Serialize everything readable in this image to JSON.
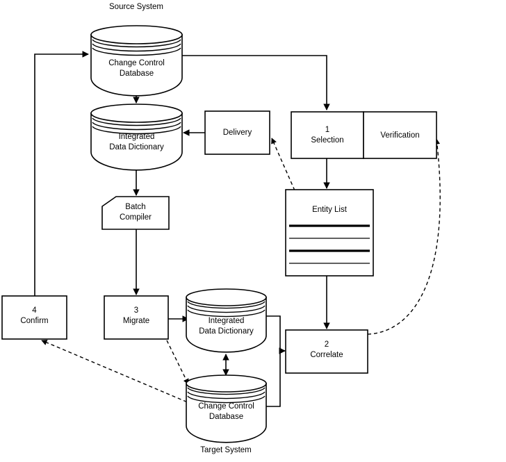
{
  "diagram": {
    "title": "Data dictionary migration flow diagram",
    "captions": {
      "source_system": "Source System",
      "target_system": "Target System"
    },
    "colors": {
      "stroke": "#000000",
      "fill": "#ffffff",
      "background": "#ffffff"
    },
    "nodes": {
      "source_change_control_db": {
        "label_line1": "Change Control",
        "label_line2": "Database",
        "shape": "cylinder-database"
      },
      "source_integrated_dd": {
        "label_line1": "Integrated",
        "label_line2": "Data Dictionary",
        "shape": "cylinder-database"
      },
      "batch_compiler": {
        "label_line1": "Batch",
        "label_line2": "Compiler",
        "shape": "chamfered-rectangle"
      },
      "delivery": {
        "label": "Delivery",
        "shape": "rectangle"
      },
      "selection": {
        "number": "1",
        "label": "Selection",
        "shape": "rectangle"
      },
      "verification": {
        "label": "Verification",
        "shape": "rectangle"
      },
      "entity_list": {
        "label": "Entity List",
        "shape": "document-list",
        "rules": [
          "thick",
          "thin",
          "thick",
          "thin"
        ]
      },
      "correlate": {
        "number": "2",
        "label": "Correlate",
        "shape": "rectangle"
      },
      "migrate": {
        "number": "3",
        "label": "Migrate",
        "shape": "rectangle"
      },
      "confirm": {
        "number": "4",
        "label": "Confirm",
        "shape": "rectangle"
      },
      "target_integrated_dd": {
        "label_line1": "Integrated",
        "label_line2": "Data Dictionary",
        "shape": "cylinder-database"
      },
      "target_change_control_db": {
        "label_line1": "Change Control",
        "label_line2": "Database",
        "shape": "cylinder-database"
      }
    },
    "edges": [
      {
        "name": "confirm-to-source-change-control",
        "from": "confirm",
        "to": "source_change_control_db",
        "style": "solid",
        "arrow": "end"
      },
      {
        "name": "source-change-control-to-selection",
        "from": "source_change_control_db",
        "to": "selection",
        "style": "solid",
        "arrow": "end"
      },
      {
        "name": "source-change-control-to-integrated-dd",
        "from": "source_change_control_db",
        "to": "source_integrated_dd",
        "style": "solid",
        "arrow": "both"
      },
      {
        "name": "delivery-to-source-integrated-dd",
        "from": "delivery",
        "to": "source_integrated_dd",
        "style": "solid",
        "arrow": "end"
      },
      {
        "name": "source-integrated-dd-to-batch-compiler",
        "from": "source_integrated_dd",
        "to": "batch_compiler",
        "style": "solid",
        "arrow": "end"
      },
      {
        "name": "batch-compiler-to-migrate",
        "from": "batch_compiler",
        "to": "migrate",
        "style": "solid",
        "arrow": "end"
      },
      {
        "name": "selection-to-entity-list",
        "from": "selection",
        "to": "entity_list",
        "style": "solid",
        "arrow": "end"
      },
      {
        "name": "entity-list-to-delivery",
        "from": "entity_list",
        "to": "delivery",
        "style": "dashed",
        "arrow": "end"
      },
      {
        "name": "entity-list-to-correlate",
        "from": "entity_list",
        "to": "correlate",
        "style": "solid",
        "arrow": "end"
      },
      {
        "name": "correlate-to-verification",
        "from": "correlate",
        "to": "verification",
        "style": "dashed",
        "arrow": "end"
      },
      {
        "name": "migrate-to-target-integrated-dd",
        "from": "migrate",
        "to": "target_integrated_dd",
        "style": "solid",
        "arrow": "end"
      },
      {
        "name": "migrate-to-target-change-control",
        "from": "migrate",
        "to": "target_change_control_db",
        "style": "dashed",
        "arrow": "end"
      },
      {
        "name": "target-integrated-dd-to-target-change-control",
        "from": "target_integrated_dd",
        "to": "target_change_control_db",
        "style": "solid",
        "arrow": "both"
      },
      {
        "name": "target-databases-to-correlate",
        "from": "target_change_control_db",
        "to": "correlate",
        "style": "solid",
        "arrow": "end"
      },
      {
        "name": "target-change-control-to-confirm",
        "from": "target_change_control_db",
        "to": "confirm",
        "style": "dashed",
        "arrow": "end"
      }
    ]
  }
}
